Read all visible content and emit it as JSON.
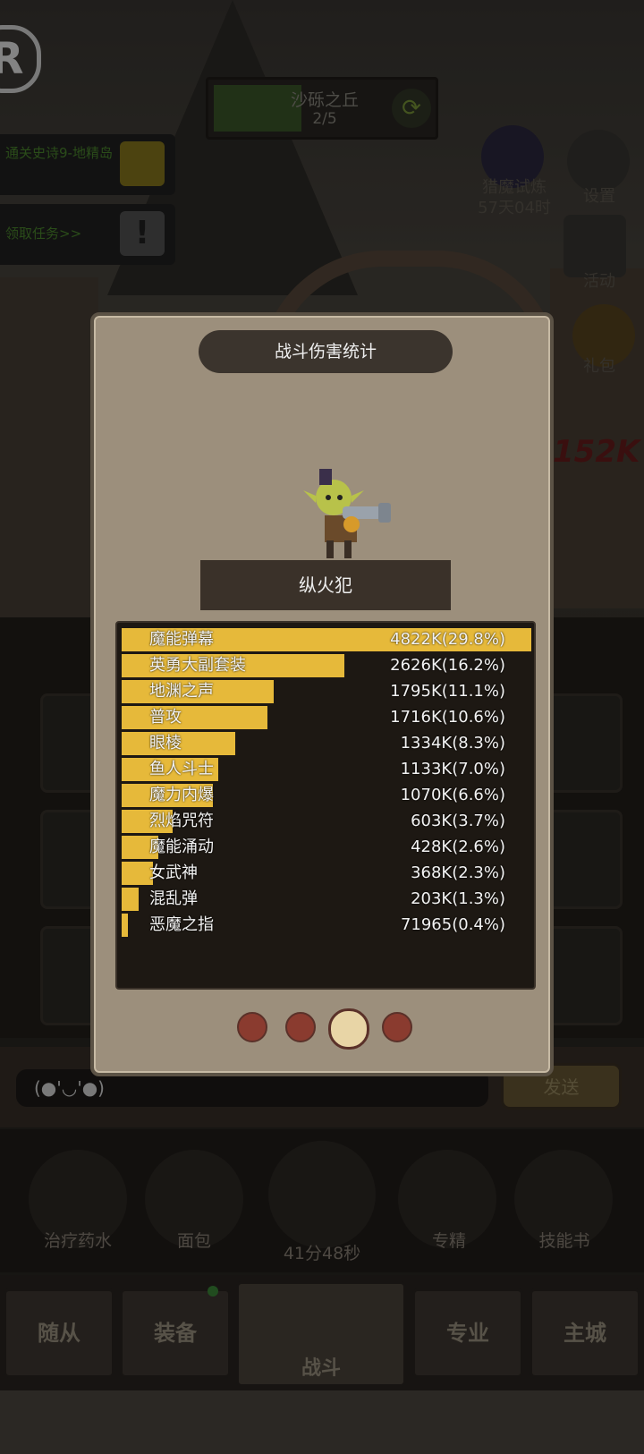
{
  "logo": "R",
  "stage": {
    "name": "沙砾之丘",
    "progress": "2/5",
    "refresh_icon": "refresh-icon"
  },
  "quests": [
    {
      "text": "通关史诗9-地精岛",
      "icon": "trophy-icon"
    },
    {
      "text": "领取任务>>",
      "icon": "exclamation-icon"
    }
  ],
  "side_menu": {
    "hunt": {
      "label": "猎魔试炼",
      "timer": "57天04时"
    },
    "settings": {
      "label": "设置"
    },
    "activity": {
      "label": "活动"
    },
    "gift": {
      "label": "礼包"
    }
  },
  "floating_damage": "152K",
  "chat": {
    "input_text": "(●'◡'●)",
    "send_label": "发送"
  },
  "items": [
    {
      "label": "治疗药水",
      "icon": "potion-icon"
    },
    {
      "label": "面包",
      "icon": "bread-icon"
    },
    {
      "label": "41分48秒",
      "icon": "chest-icon"
    },
    {
      "label": "专精",
      "icon": "specialization-icon"
    },
    {
      "label": "技能书",
      "icon": "skillbook-icon"
    }
  ],
  "nav": {
    "follower": "随从",
    "equipment": "装备",
    "battle": "战斗",
    "profession": "专业",
    "main_city": "主城"
  },
  "modal": {
    "title": "战斗伤害统计",
    "hero_name": "纵火犯",
    "page_count": 4,
    "active_page": 3
  },
  "colors": {
    "bar": "#e6b93a",
    "panel": "#1d1813",
    "modal": "#9c8f7c"
  },
  "chart_data": {
    "type": "bar",
    "title": "战斗伤害统计",
    "categories": [
      "魔能弹幕",
      "英勇大副套装",
      "地渊之声",
      "普攻",
      "眼棱",
      "鱼人斗士",
      "魔力内爆",
      "烈焰咒符",
      "魔能涌动",
      "女武神",
      "混乱弹",
      "恶魔之指"
    ],
    "labels": [
      "4822K(29.8%)",
      "2626K(16.2%)",
      "1795K(11.1%)",
      "1716K(10.6%)",
      "1334K(8.3%)",
      "1133K(7.0%)",
      "1070K(6.6%)",
      "603K(3.7%)",
      "428K(2.6%)",
      "368K(2.3%)",
      "203K(1.3%)",
      "71965(0.4%)"
    ],
    "values": [
      4822,
      2626,
      1795,
      1716,
      1334,
      1133,
      1070,
      603,
      428,
      368,
      203,
      72
    ],
    "unit": "K"
  }
}
